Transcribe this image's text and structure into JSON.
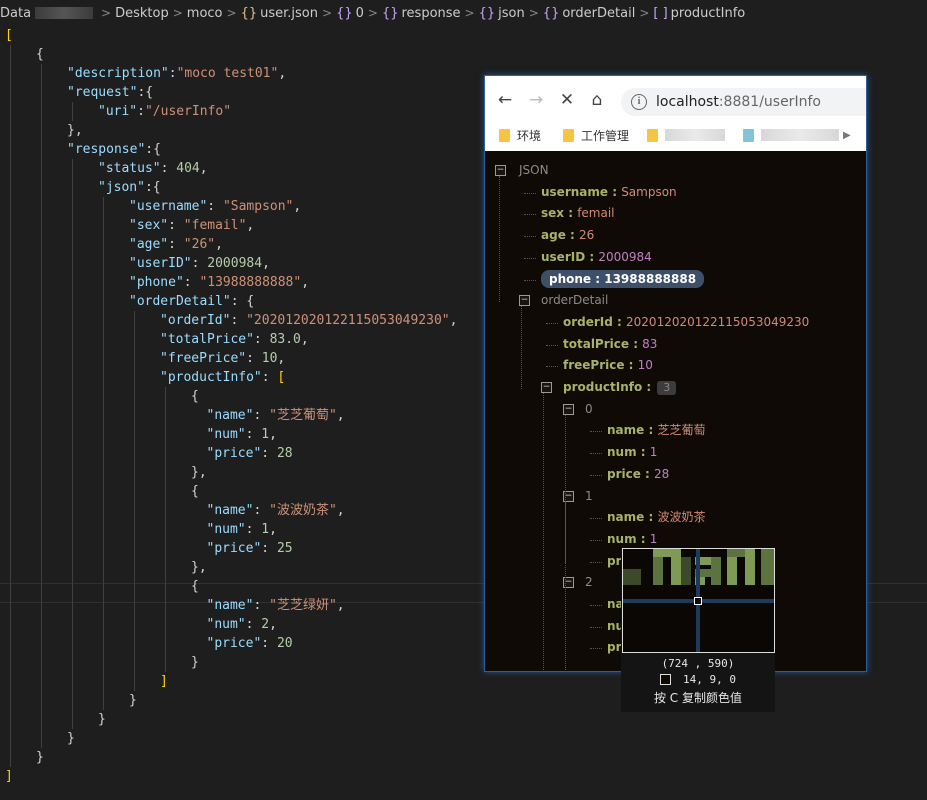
{
  "breadcrumb": {
    "items": [
      {
        "label": "Data",
        "icon": "",
        "blurred_after": true
      },
      {
        "label": "Desktop",
        "icon": ""
      },
      {
        "label": "moco",
        "icon": ""
      },
      {
        "label": "user.json",
        "icon": "json-file-icon"
      },
      {
        "label": "0",
        "icon": "object-icon"
      },
      {
        "label": "response",
        "icon": "object-icon"
      },
      {
        "label": "json",
        "icon": "object-icon"
      },
      {
        "label": "orderDetail",
        "icon": "object-icon"
      },
      {
        "label": "productInfo",
        "icon": "array-icon"
      }
    ],
    "separator": ">",
    "object_icon_glyph": "{}",
    "array_icon_glyph": "[ ]"
  },
  "code": {
    "lines": [
      {
        "indent": 0,
        "tokens": [
          [
            "b",
            "["
          ]
        ]
      },
      {
        "indent": 1,
        "tokens": [
          [
            "p",
            "{"
          ]
        ]
      },
      {
        "indent": 2,
        "tokens": [
          [
            "k",
            "\"description\""
          ],
          [
            "p",
            ":"
          ],
          [
            "s",
            "\"moco test01\""
          ],
          [
            "p",
            ","
          ]
        ]
      },
      {
        "indent": 2,
        "tokens": [
          [
            "k",
            "\"request\""
          ],
          [
            "p",
            ":{"
          ]
        ]
      },
      {
        "indent": 3,
        "tokens": [
          [
            "k",
            "\"uri\""
          ],
          [
            "p",
            ":"
          ],
          [
            "s",
            "\"/userInfo\""
          ]
        ]
      },
      {
        "indent": 2,
        "tokens": [
          [
            "p",
            "},"
          ]
        ]
      },
      {
        "indent": 2,
        "tokens": [
          [
            "k",
            "\"response\""
          ],
          [
            "p",
            ":{"
          ]
        ]
      },
      {
        "indent": 3,
        "tokens": [
          [
            "k",
            "\"status\""
          ],
          [
            "p",
            ": "
          ],
          [
            "n",
            "404"
          ],
          [
            "p",
            ","
          ]
        ]
      },
      {
        "indent": 3,
        "tokens": [
          [
            "k",
            "\"json\""
          ],
          [
            "p",
            ":{"
          ]
        ]
      },
      {
        "indent": 4,
        "tokens": [
          [
            "k",
            "\"username\""
          ],
          [
            "p",
            ": "
          ],
          [
            "s",
            "\"Sampson\""
          ],
          [
            "p",
            ","
          ]
        ]
      },
      {
        "indent": 4,
        "tokens": [
          [
            "k",
            "\"sex\""
          ],
          [
            "p",
            ": "
          ],
          [
            "s",
            "\"femail\""
          ],
          [
            "p",
            ","
          ]
        ]
      },
      {
        "indent": 4,
        "tokens": [
          [
            "k",
            "\"age\""
          ],
          [
            "p",
            ": "
          ],
          [
            "s",
            "\"26\""
          ],
          [
            "p",
            ","
          ]
        ]
      },
      {
        "indent": 4,
        "tokens": [
          [
            "k",
            "\"userID\""
          ],
          [
            "p",
            ": "
          ],
          [
            "n",
            "2000984"
          ],
          [
            "p",
            ","
          ]
        ]
      },
      {
        "indent": 4,
        "tokens": [
          [
            "k",
            "\"phone\""
          ],
          [
            "p",
            ": "
          ],
          [
            "s",
            "\"13988888888\""
          ],
          [
            "p",
            ","
          ]
        ]
      },
      {
        "indent": 4,
        "tokens": [
          [
            "k",
            "\"orderDetail\""
          ],
          [
            "p",
            ": {"
          ]
        ]
      },
      {
        "indent": 5,
        "tokens": [
          [
            "k",
            "\"orderId\""
          ],
          [
            "p",
            ": "
          ],
          [
            "s",
            "\"202012020122115053049230\""
          ],
          [
            "p",
            ","
          ]
        ]
      },
      {
        "indent": 5,
        "tokens": [
          [
            "k",
            "\"totalPrice\""
          ],
          [
            "p",
            ": "
          ],
          [
            "n",
            "83.0"
          ],
          [
            "p",
            ","
          ]
        ]
      },
      {
        "indent": 5,
        "tokens": [
          [
            "k",
            "\"freePrice\""
          ],
          [
            "p",
            ": "
          ],
          [
            "n",
            "10"
          ],
          [
            "p",
            ","
          ]
        ]
      },
      {
        "indent": 5,
        "tokens": [
          [
            "k",
            "\"productInfo\""
          ],
          [
            "p",
            ": "
          ],
          [
            "b",
            "["
          ]
        ]
      },
      {
        "indent": 6,
        "tokens": [
          [
            "p",
            "{"
          ]
        ]
      },
      {
        "indent": 6,
        "tokens": [
          [
            "k",
            "\"name\""
          ],
          [
            "p",
            ": "
          ],
          [
            "s",
            "\"芝芝葡萄\""
          ],
          [
            "p",
            ","
          ]
        ],
        "pad": 1
      },
      {
        "indent": 6,
        "tokens": [
          [
            "k",
            "\"num\""
          ],
          [
            "p",
            ": "
          ],
          [
            "n",
            "1"
          ],
          [
            "p",
            ","
          ]
        ],
        "pad": 1
      },
      {
        "indent": 6,
        "tokens": [
          [
            "k",
            "\"price\""
          ],
          [
            "p",
            ": "
          ],
          [
            "n",
            "28"
          ]
        ],
        "pad": 1
      },
      {
        "indent": 6,
        "tokens": [
          [
            "p",
            "},"
          ]
        ]
      },
      {
        "indent": 6,
        "tokens": [
          [
            "p",
            "{"
          ]
        ]
      },
      {
        "indent": 6,
        "tokens": [
          [
            "k",
            "\"name\""
          ],
          [
            "p",
            ": "
          ],
          [
            "s",
            "\"波波奶茶\""
          ],
          [
            "p",
            ","
          ]
        ],
        "pad": 1
      },
      {
        "indent": 6,
        "tokens": [
          [
            "k",
            "\"num\""
          ],
          [
            "p",
            ": "
          ],
          [
            "n",
            "1"
          ],
          [
            "p",
            ","
          ]
        ],
        "pad": 1
      },
      {
        "indent": 6,
        "tokens": [
          [
            "k",
            "\"price\""
          ],
          [
            "p",
            ": "
          ],
          [
            "n",
            "25"
          ]
        ],
        "pad": 1
      },
      {
        "indent": 6,
        "tokens": [
          [
            "p",
            "},"
          ]
        ]
      },
      {
        "indent": 6,
        "tokens": [
          [
            "p",
            "{"
          ]
        ]
      },
      {
        "indent": 6,
        "tokens": [
          [
            "k",
            "\"name\""
          ],
          [
            "p",
            ": "
          ],
          [
            "s",
            "\"芝芝绿妍\""
          ],
          [
            "p",
            ","
          ]
        ],
        "pad": 1
      },
      {
        "indent": 6,
        "tokens": [
          [
            "k",
            "\"num\""
          ],
          [
            "p",
            ": "
          ],
          [
            "n",
            "2"
          ],
          [
            "p",
            ","
          ]
        ],
        "pad": 1
      },
      {
        "indent": 6,
        "tokens": [
          [
            "k",
            "\"price\""
          ],
          [
            "p",
            ": "
          ],
          [
            "n",
            "20"
          ]
        ],
        "pad": 1
      },
      {
        "indent": 6,
        "tokens": [
          [
            "p",
            "}"
          ]
        ]
      },
      {
        "indent": 5,
        "tokens": [
          [
            "b",
            "]"
          ]
        ]
      },
      {
        "indent": 4,
        "tokens": [
          [
            "p",
            "}"
          ]
        ]
      },
      {
        "indent": 3,
        "tokens": [
          [
            "p",
            "}"
          ]
        ]
      },
      {
        "indent": 2,
        "tokens": [
          [
            "p",
            "}"
          ]
        ]
      },
      {
        "indent": 1,
        "tokens": [
          [
            "p",
            "}"
          ]
        ]
      },
      {
        "indent": 0,
        "tokens": [
          [
            "b",
            "]"
          ]
        ]
      }
    ]
  },
  "browser": {
    "url_host": "localhost",
    "url_path": ":8881/userInfo",
    "bookmarks": [
      {
        "label": "环境"
      },
      {
        "label": "工作管理"
      }
    ],
    "json_root": "JSON",
    "json_rows": [
      {
        "depth": 1,
        "key": "username",
        "value": "Sampson",
        "vtype": "s"
      },
      {
        "depth": 1,
        "key": "sex",
        "value": "femail",
        "vtype": "s"
      },
      {
        "depth": 1,
        "key": "age",
        "value": "26",
        "vtype": "s"
      },
      {
        "depth": 1,
        "key": "userID",
        "value": "2000984",
        "vtype": "n"
      },
      {
        "depth": 1,
        "key": "phone",
        "value": "13988888888",
        "vtype": "s",
        "selected": true
      },
      {
        "depth": 1,
        "key": "orderDetail",
        "value": "",
        "group": true
      },
      {
        "depth": 2,
        "key": "orderId",
        "value": "202012020122115053049230",
        "vtype": "s"
      },
      {
        "depth": 2,
        "key": "totalPrice",
        "value": "83",
        "vtype": "n"
      },
      {
        "depth": 2,
        "key": "freePrice",
        "value": "10",
        "vtype": "n"
      },
      {
        "depth": 2,
        "key": "productInfo",
        "value": "",
        "group": true,
        "count": "3"
      },
      {
        "depth": 3,
        "key": "0",
        "value": "",
        "group": true,
        "index": true
      },
      {
        "depth": 4,
        "key": "name",
        "value": "芝芝葡萄",
        "vtype": "s"
      },
      {
        "depth": 4,
        "key": "num",
        "value": "1",
        "vtype": "n"
      },
      {
        "depth": 4,
        "key": "price",
        "value": "28",
        "vtype": "n"
      },
      {
        "depth": 3,
        "key": "1",
        "value": "",
        "group": true,
        "index": true
      },
      {
        "depth": 4,
        "key": "name",
        "value": "波波奶茶",
        "vtype": "s"
      },
      {
        "depth": 4,
        "key": "num",
        "value": "1",
        "vtype": "n"
      },
      {
        "depth": 4,
        "key": "pri",
        "value": "",
        "vtype": "n"
      },
      {
        "depth": 3,
        "key": "2",
        "value": "",
        "group": true,
        "index": true
      },
      {
        "depth": 4,
        "key": "na",
        "value": "",
        "vtype": "s"
      },
      {
        "depth": 4,
        "key": "nu",
        "value": "",
        "vtype": "n"
      },
      {
        "depth": 4,
        "key": "pri",
        "value": "",
        "vtype": "n"
      }
    ]
  },
  "magnifier": {
    "coords": "(724 , 590)",
    "rgb": "14,   9,   0",
    "hint": "按 C 复制颜色值",
    "swatch_color": "#0e0900"
  },
  "colors": {
    "json_key": "#a8b36a",
    "json_string": "#d08b74",
    "json_number": "#c27fc6",
    "code_key": "#9cdcfe",
    "code_string": "#ce9178",
    "code_number": "#b5cea8"
  }
}
